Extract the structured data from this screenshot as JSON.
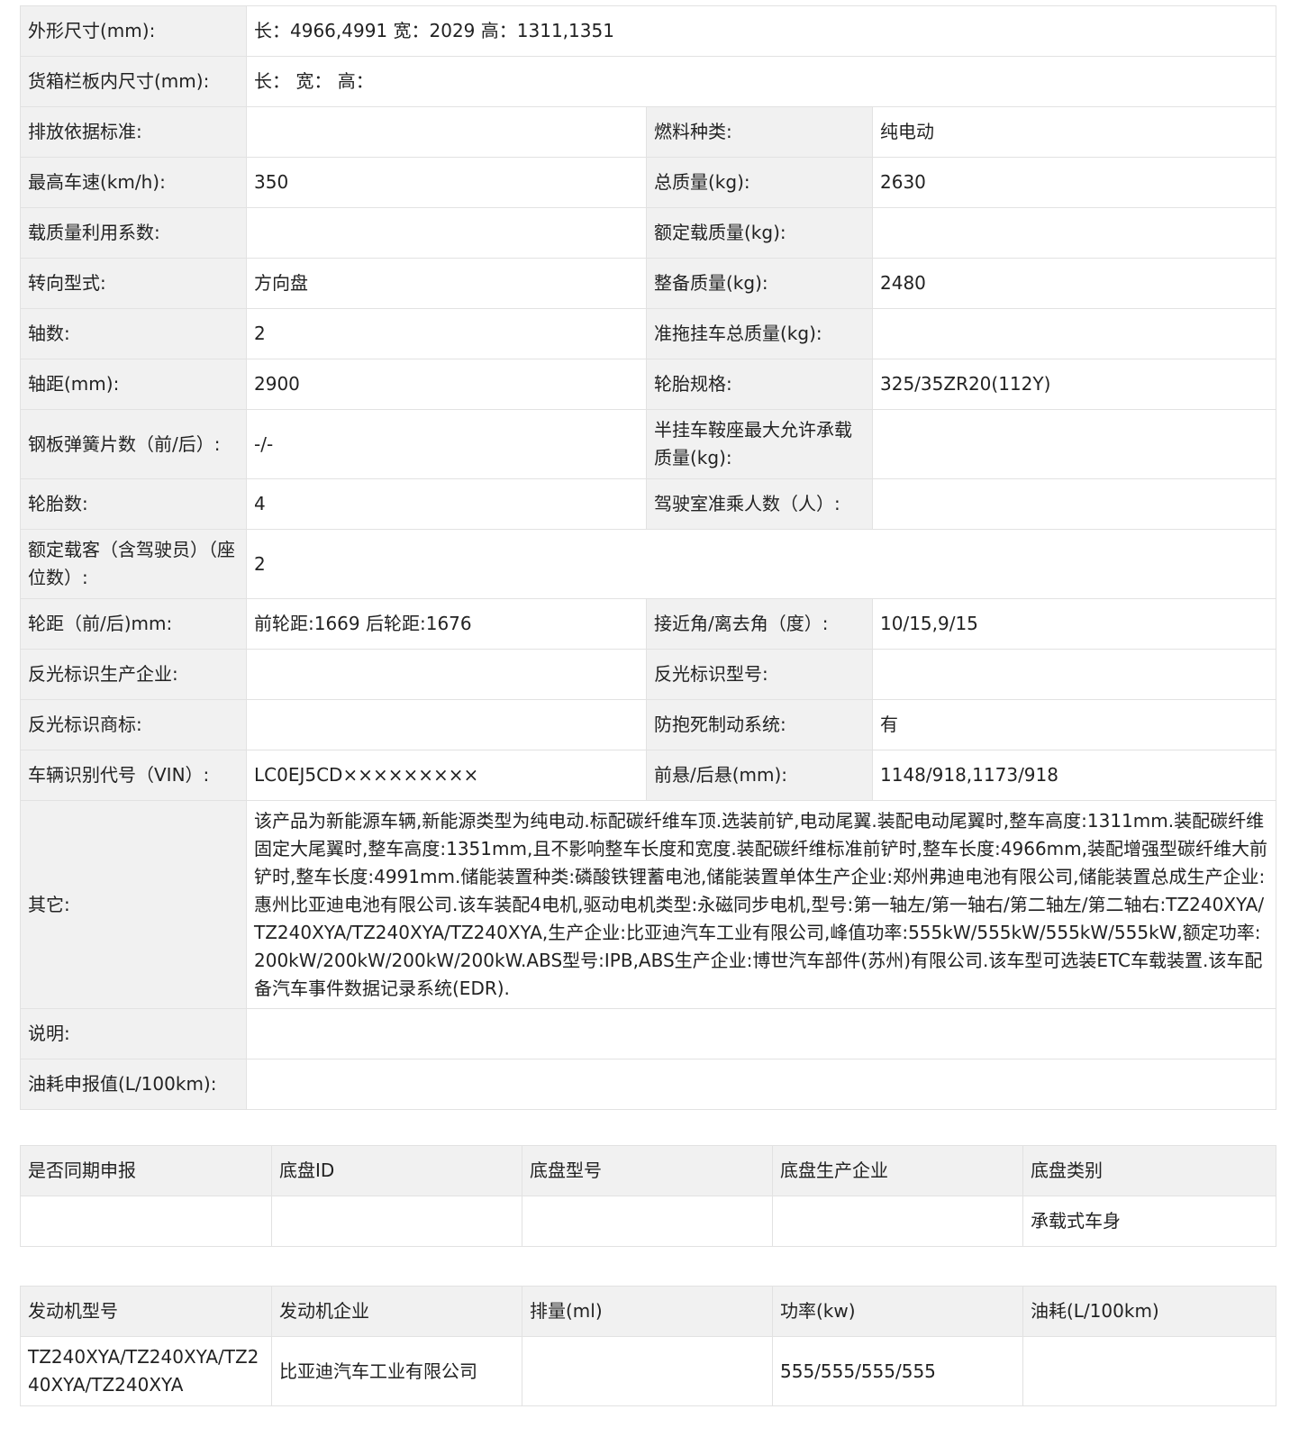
{
  "spec": {
    "dimensions": {
      "label": "外形尺寸(mm):",
      "value": "长：4966,4991 宽：2029 高：1311,1351"
    },
    "cargo_box": {
      "label": "货箱栏板内尺寸(mm):",
      "value": "长：  宽：  高："
    },
    "emission_standard": {
      "label": "排放依据标准:",
      "value": ""
    },
    "fuel_type": {
      "label": "燃料种类:",
      "value": "纯电动"
    },
    "max_speed": {
      "label": "最高车速(km/h):",
      "value": "350"
    },
    "total_mass": {
      "label": "总质量(kg):",
      "value": "2630"
    },
    "load_coefficient": {
      "label": "载质量利用系数:",
      "value": ""
    },
    "rated_load": {
      "label": "额定载质量(kg):",
      "value": ""
    },
    "steering": {
      "label": "转向型式:",
      "value": "方向盘"
    },
    "curb_mass": {
      "label": "整备质量(kg):",
      "value": "2480"
    },
    "axles": {
      "label": "轴数:",
      "value": "2"
    },
    "trailer_mass": {
      "label": "准拖挂车总质量(kg):",
      "value": ""
    },
    "wheelbase": {
      "label": "轴距(mm):",
      "value": "2900"
    },
    "tire_spec": {
      "label": "轮胎规格:",
      "value": "325/35ZR20(112Y)"
    },
    "leaf_springs": {
      "label": "钢板弹簧片数（前/后）:",
      "value": "-/-"
    },
    "saddle_load": {
      "label": "半挂车鞍座最大允许承载质量(kg):",
      "value": ""
    },
    "tire_count": {
      "label": "轮胎数:",
      "value": "4"
    },
    "cab_passengers": {
      "label": "驾驶室准乘人数（人）:",
      "value": ""
    },
    "rated_passengers": {
      "label": "额定载客（含驾驶员）（座位数）:",
      "value": "2"
    },
    "track": {
      "label": "轮距（前/后)mm:",
      "value": "前轮距:1669 后轮距:1676"
    },
    "approach_angle": {
      "label": "接近角/离去角（度）:",
      "value": "10/15,9/15"
    },
    "reflector_maker": {
      "label": "反光标识生产企业:",
      "value": ""
    },
    "reflector_model": {
      "label": "反光标识型号:",
      "value": ""
    },
    "reflector_brand": {
      "label": "反光标识商标:",
      "value": ""
    },
    "abs": {
      "label": "防抱死制动系统:",
      "value": "有"
    },
    "vin": {
      "label": "车辆识别代号（VIN）:",
      "value": "LC0EJ5CD×××××××××"
    },
    "overhang": {
      "label": "前悬/后悬(mm):",
      "value": "1148/918,1173/918"
    },
    "other": {
      "label": "其它:",
      "value": "该产品为新能源车辆,新能源类型为纯电动.标配碳纤维车顶.选装前铲,电动尾翼.装配电动尾翼时,整车高度:1311mm.装配碳纤维固定大尾翼时,整车高度:1351mm,且不影响整车长度和宽度.装配碳纤维标准前铲时,整车长度:4966mm,装配增强型碳纤维大前铲时,整车长度:4991mm.储能装置种类:磷酸铁锂蓄电池,储能装置单体生产企业:郑州弗迪电池有限公司,储能装置总成生产企业:惠州比亚迪电池有限公司.该车装配4电机,驱动电机类型:永磁同步电机,型号:第一轴左/第一轴右/第二轴左/第二轴右:TZ240XYA/TZ240XYA/TZ240XYA/TZ240XYA,生产企业:比亚迪汽车工业有限公司,峰值功率:555kW/555kW/555kW/555kW,额定功率:200kW/200kW/200kW/200kW.ABS型号:IPB,ABS生产企业:博世汽车部件(苏州)有限公司.该车型可选装ETC车载装置.该车配备汽车事件数据记录系统(EDR)."
    },
    "note": {
      "label": "说明:",
      "value": ""
    },
    "fuel_consumption": {
      "label": "油耗申报值(L/100km):",
      "value": ""
    }
  },
  "chassis": {
    "headers": [
      "是否同期申报",
      "底盘ID",
      "底盘型号",
      "底盘生产企业",
      "底盘类别"
    ],
    "row": [
      "",
      "",
      "",
      "",
      "承载式车身"
    ]
  },
  "engine": {
    "headers": [
      "发动机型号",
      "发动机企业",
      "排量(ml)",
      "功率(kw)",
      "油耗(L/100km)"
    ],
    "row": [
      "TZ240XYA/TZ240XYA/TZ240XYA/TZ240XYA",
      "比亚迪汽车工业有限公司",
      "",
      "555/555/555/555",
      ""
    ]
  }
}
